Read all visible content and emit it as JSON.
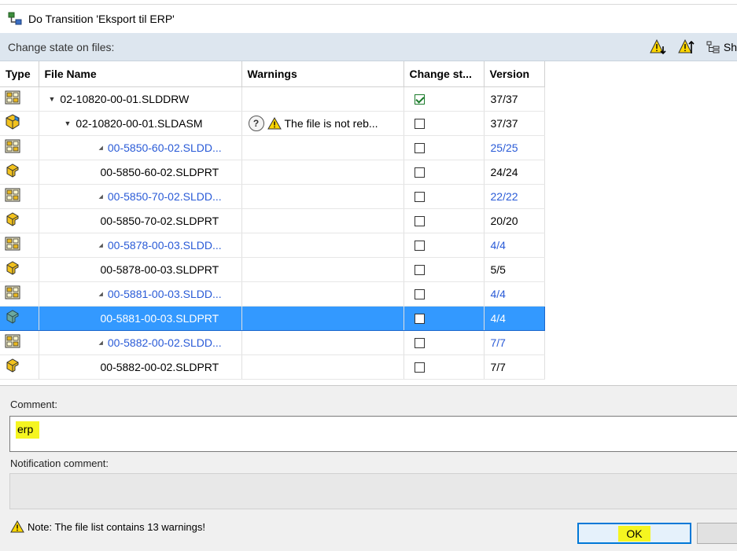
{
  "window": {
    "title": "Do Transition 'Eksport til ERP'"
  },
  "toolbar": {
    "label": "Change state on files:",
    "show_label": "Sh"
  },
  "grid": {
    "columns": {
      "type": "Type",
      "file_name": "File Name",
      "warnings": "Warnings",
      "change_state": "Change st...",
      "version": "Version"
    },
    "rows": [
      {
        "icon": "drawing-icon",
        "name": "02-10820-00-01.SLDDRW",
        "indent": 1,
        "tri": "expanded",
        "blue": false,
        "warning": "",
        "checked": true,
        "version": "37/37",
        "version_blue": false,
        "selected": false
      },
      {
        "icon": "assembly-icon",
        "name": "02-10820-00-01.SLDASM",
        "indent": 2,
        "tri": "expanded",
        "blue": false,
        "warning": "The file is not reb...",
        "checked": false,
        "version": "37/37",
        "version_blue": false,
        "selected": false
      },
      {
        "icon": "drawing-icon",
        "name": "00-5850-60-02.SLDD...",
        "indent": 3,
        "tri": "small",
        "blue": true,
        "warning": "",
        "checked": false,
        "version": "25/25",
        "version_blue": true,
        "selected": false
      },
      {
        "icon": "part-icon",
        "name": "00-5850-60-02.SLDPRT",
        "indent": 4,
        "tri": "none",
        "blue": false,
        "warning": "",
        "checked": false,
        "version": "24/24",
        "version_blue": false,
        "selected": false
      },
      {
        "icon": "drawing-icon",
        "name": "00-5850-70-02.SLDD...",
        "indent": 3,
        "tri": "small",
        "blue": true,
        "warning": "",
        "checked": false,
        "version": "22/22",
        "version_blue": true,
        "selected": false
      },
      {
        "icon": "part-icon",
        "name": "00-5850-70-02.SLDPRT",
        "indent": 4,
        "tri": "none",
        "blue": false,
        "warning": "",
        "checked": false,
        "version": "20/20",
        "version_blue": false,
        "selected": false
      },
      {
        "icon": "drawing-icon",
        "name": "00-5878-00-03.SLDD...",
        "indent": 3,
        "tri": "small",
        "blue": true,
        "warning": "",
        "checked": false,
        "version": "4/4",
        "version_blue": true,
        "selected": false
      },
      {
        "icon": "part-icon",
        "name": "00-5878-00-03.SLDPRT",
        "indent": 4,
        "tri": "none",
        "blue": false,
        "warning": "",
        "checked": false,
        "version": "5/5",
        "version_blue": false,
        "selected": false
      },
      {
        "icon": "drawing-icon",
        "name": "00-5881-00-03.SLDD...",
        "indent": 3,
        "tri": "small",
        "blue": true,
        "warning": "",
        "checked": false,
        "version": "4/4",
        "version_blue": true,
        "selected": false
      },
      {
        "icon": "part-icon",
        "name": "00-5881-00-03.SLDPRT",
        "indent": 4,
        "tri": "none",
        "blue": false,
        "warning": "",
        "checked": false,
        "version": "4/4",
        "version_blue": false,
        "selected": true
      },
      {
        "icon": "drawing-icon",
        "name": "00-5882-00-02.SLDD...",
        "indent": 3,
        "tri": "small",
        "blue": true,
        "warning": "",
        "checked": false,
        "version": "7/7",
        "version_blue": true,
        "selected": false
      },
      {
        "icon": "part-icon",
        "name": "00-5882-00-02.SLDPRT",
        "indent": 4,
        "tri": "none",
        "blue": false,
        "warning": "",
        "checked": false,
        "version": "7/7",
        "version_blue": false,
        "selected": false
      }
    ]
  },
  "comment": {
    "label": "Comment:",
    "value": "erp"
  },
  "notification": {
    "label": "Notification comment:",
    "value": ""
  },
  "note": {
    "text": "Note: The file list contains 13 warnings!"
  },
  "buttons": {
    "ok": "OK"
  },
  "colors": {
    "selection": "#3399ff",
    "link_blue": "#2a5bd7",
    "highlight": "#f5f520",
    "toolbar_bg": "#dde6ef"
  }
}
